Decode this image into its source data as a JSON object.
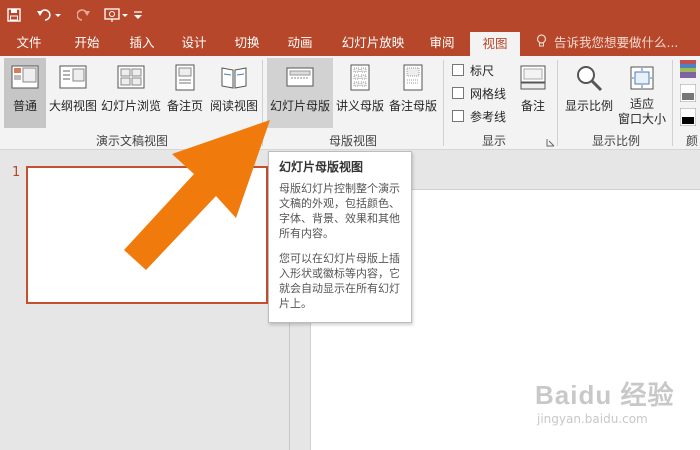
{
  "quick_access": {
    "save_icon": "save-icon",
    "undo_icon": "undo-icon",
    "redo_icon": "redo-icon",
    "present_icon": "present-from-start-icon",
    "customize_icon": "customize-toolbar-icon"
  },
  "tabs": [
    "文件",
    "开始",
    "插入",
    "设计",
    "切换",
    "动画",
    "幻灯片放映",
    "审阅",
    "视图"
  ],
  "active_tab": "视图",
  "tell_me": "告诉我您想要做什么...",
  "ribbon": {
    "presentation_views": {
      "buttons": [
        "普通",
        "大纲视图",
        "幻灯片浏览",
        "备注页",
        "阅读视图"
      ],
      "group_label": "演示文稿视图"
    },
    "master_views": {
      "buttons": [
        "幻灯片母版",
        "讲义母版",
        "备注母版"
      ],
      "group_label": "母版视图"
    },
    "show": {
      "checkboxes": [
        "标尺",
        "网格线",
        "参考线"
      ],
      "group_label": "显示"
    },
    "notes": {
      "label": "备注"
    },
    "zoom": {
      "buttons": [
        "显示比例",
        "适应\n窗口大小"
      ],
      "group_label": "显示比例"
    },
    "color_group_label": "颜"
  },
  "tooltip": {
    "title": "幻灯片母版视图",
    "paragraph1": "母版幻灯片控制整个演示文稿的外观，包括颜色、字体、背景、效果和其他所有内容。",
    "paragraph2": "您可以在幻灯片母版上插入形状或徽标等内容，它就会自动显示在所有幻灯片上。"
  },
  "slide_panel": {
    "slide_number": "1"
  },
  "colors": {
    "accent": "#b7472a",
    "arrow": "#f07a0c"
  },
  "watermark": {
    "main": "Baidu 经验",
    "sub": "jingyan.baidu.com"
  }
}
